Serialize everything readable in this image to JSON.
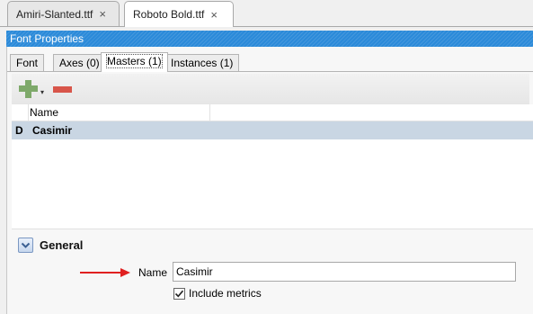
{
  "doc_tabs": [
    {
      "label": "Amiri-Slanted.ttf",
      "close": "×",
      "active": false
    },
    {
      "label": "Roboto Bold.ttf",
      "close": "×",
      "active": true
    }
  ],
  "panel": {
    "title": "Font Properties",
    "tabs": [
      {
        "label": "Font"
      },
      {
        "label": "Axes (0)"
      },
      {
        "label": "Masters (1)",
        "active": true
      },
      {
        "label": "Instances (1)"
      }
    ]
  },
  "toolbar": {
    "add_icon": "plus-icon",
    "add_caret": "▾",
    "remove_icon": "minus-icon",
    "add_color": "#7ea96a",
    "remove_color": "#d8554a"
  },
  "masters_list": {
    "column_name": "Name",
    "rows": [
      {
        "flag": "D",
        "name": "Casimir",
        "selected": true
      }
    ]
  },
  "general": {
    "title": "General",
    "name_label": "Name",
    "name_value": "Casimir",
    "include_metrics_label": "Include metrics",
    "include_metrics_checked": true,
    "annotation_arrow_color": "#e02020"
  },
  "colors": {
    "header_blue": "#2b8ad9",
    "selection": "#c9d6e3"
  }
}
